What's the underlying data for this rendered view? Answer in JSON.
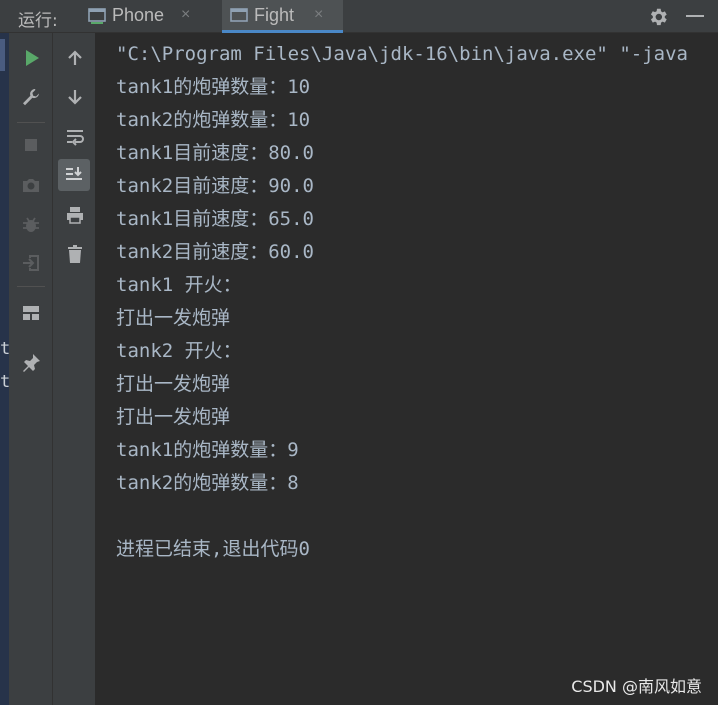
{
  "tabbar": {
    "run_label": "运行:",
    "tabs": [
      {
        "label": "Phone",
        "close": "×",
        "icon": "console-icon"
      },
      {
        "label": "Fight",
        "close": "×",
        "icon": "console-icon",
        "active": true
      }
    ],
    "settings_icon": "gear-icon",
    "minimize_icon": "minimize-icon"
  },
  "left_strip": {
    "chars": [
      "t",
      "t"
    ]
  },
  "toolbar_left": [
    "run-icon",
    "wrench-icon",
    "stop-icon",
    "camera-icon",
    "bug-icon",
    "exit-icon",
    "layout-icon",
    "pin-icon"
  ],
  "toolbar_right": [
    "arrow-up-icon",
    "arrow-down-icon",
    "soft-wrap-icon",
    "scroll-to-end-icon",
    "print-icon",
    "trash-icon"
  ],
  "console": {
    "lines": [
      "\"C:\\Program Files\\Java\\jdk-16\\bin\\java.exe\" \"-java",
      "tank1的炮弹数量：10",
      "tank2的炮弹数量：10",
      "tank1目前速度：80.0",
      "tank2目前速度：90.0",
      "tank1目前速度：65.0",
      "tank2目前速度：60.0",
      "tank1 开火：",
      "打出一发炮弹",
      "tank2 开火：",
      "打出一发炮弹",
      "打出一发炮弹",
      "tank1的炮弹数量：9",
      "tank2的炮弹数量：8",
      "",
      "进程已结束,退出代码0"
    ]
  },
  "watermark": "CSDN @南风如意",
  "colors": {
    "background": "#2b2b2b",
    "panel": "#3c3f41",
    "text": "#a9b7c6",
    "accent": "#4a88c7",
    "run_green": "#59a869"
  }
}
